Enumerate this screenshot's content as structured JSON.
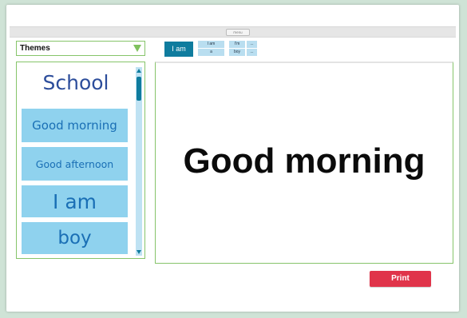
{
  "toolbar": {
    "handle_label": "menu"
  },
  "themes": {
    "label": "Themes",
    "icon": "triangle-down-icon"
  },
  "word_buttons": {
    "primary": "I am",
    "mini": [
      "I am",
      "a",
      "I'm",
      "...",
      "boy",
      "..."
    ]
  },
  "list": {
    "heading": "School",
    "items": [
      "Good morning",
      "Good afternoon",
      "I am",
      "boy"
    ]
  },
  "display": {
    "text": "Good morning"
  },
  "print": {
    "label": "Print"
  },
  "colors": {
    "accent_green": "#86c46a",
    "button_teal": "#0f7c9e",
    "item_blue": "#8fd2ee",
    "print_red": "#e0344a"
  }
}
